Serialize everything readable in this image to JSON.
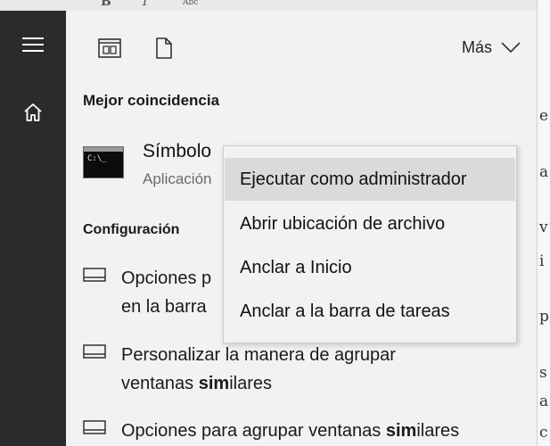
{
  "toolbar": {
    "mas_label": "Más"
  },
  "sections": {
    "best_match": "Mejor coincidencia",
    "config": "Configuración"
  },
  "best_match": {
    "title": "Símbolo",
    "subtitle": "Aplicación",
    "icon_text": "C:\\_"
  },
  "settings": [
    {
      "line1_pre": "Opciones p",
      "line1_bold": "",
      "line1_post": "",
      "line2_pre": "en la barra",
      "line2_bold": "",
      "line2_post": ""
    },
    {
      "line1_pre": "Personalizar la manera de agrupar",
      "line1_bold": "",
      "line1_post": "",
      "line2_pre": "ventanas ",
      "line2_bold": "sim",
      "line2_post": "ilares"
    },
    {
      "line1_pre": "Opciones para agrupar ventanas ",
      "line1_bold": "sim",
      "line1_post": "ilares"
    }
  ],
  "context_menu": [
    "Ejecutar como administrador",
    "Abrir ubicación de archivo",
    "Anclar a Inicio",
    "Anclar a la barra de tareas"
  ],
  "bg_doc": {
    "top_glyphs": [
      "B",
      "I",
      "Abc"
    ],
    "right_fragments": [
      "e",
      "a",
      "v",
      "i",
      "p",
      "s",
      "a",
      "c"
    ]
  },
  "colors": {
    "nav_bg": "#2b2b2b",
    "panel_bg": "#f2f2f2",
    "menu_hover": "#dadada"
  }
}
